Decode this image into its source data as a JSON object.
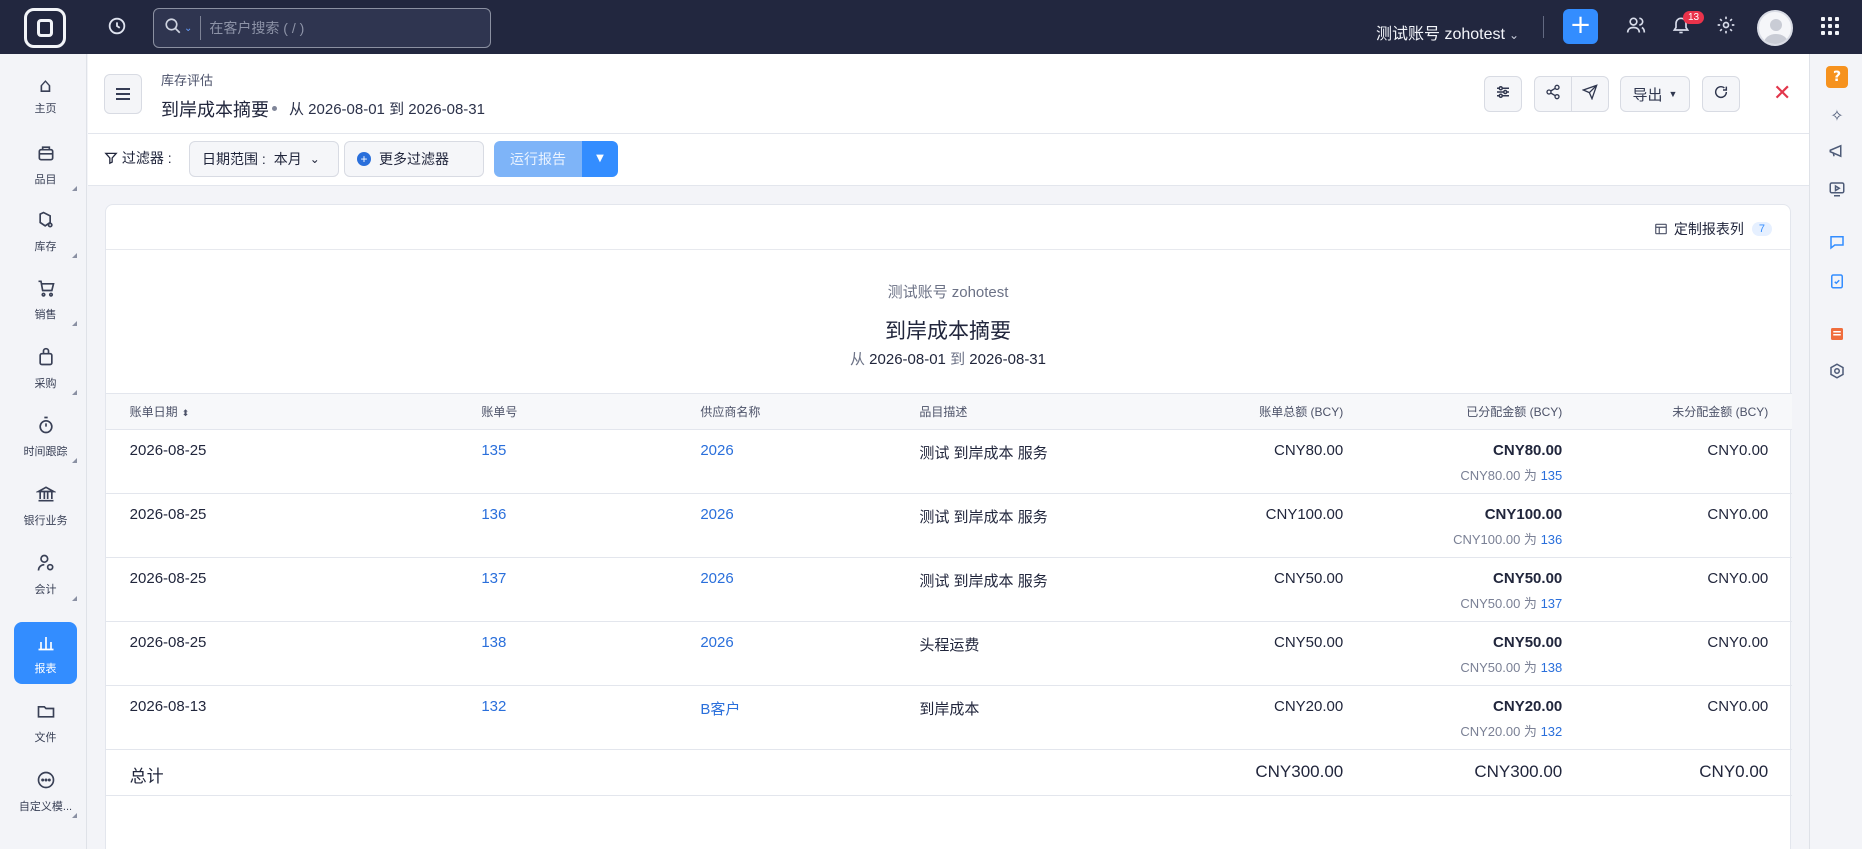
{
  "topbar": {
    "search_placeholder": "在客户搜索 ( / )",
    "org_name": "测试账号 zohotest",
    "notification_count": "13",
    "add_label": "+"
  },
  "sidebar": {
    "items": [
      {
        "label": "主页",
        "icon": "home-icon"
      },
      {
        "label": "品目",
        "icon": "items-icon"
      },
      {
        "label": "库存",
        "icon": "inventory-icon"
      },
      {
        "label": "销售",
        "icon": "cart-icon"
      },
      {
        "label": "采购",
        "icon": "bag-icon"
      },
      {
        "label": "时间跟踪",
        "icon": "stopwatch-icon"
      },
      {
        "label": "银行业务",
        "icon": "bank-icon"
      },
      {
        "label": "会计",
        "icon": "accountant-icon"
      },
      {
        "label": "报表",
        "icon": "reports-icon"
      },
      {
        "label": "文件",
        "icon": "folder-icon"
      },
      {
        "label": "自定义模...",
        "icon": "more-icon"
      }
    ],
    "active": "报表"
  },
  "header": {
    "breadcrumb": "库存评估",
    "title": "到岸成本摘要",
    "range_text": "从 2026-08-01 到 2026-08-31",
    "export_label": "导出"
  },
  "filters": {
    "label": "过滤器 :",
    "date_range_label": "日期范围 :",
    "date_range_value": "本月",
    "more_filters_label": "更多过滤器",
    "run_report_label": "运行报告"
  },
  "report": {
    "customize_columns_label": "定制报表列",
    "customize_columns_count": "7",
    "org_name": "测试账号 zohotest",
    "title": "到岸成本摘要",
    "range_from_word": "从",
    "range_start": "2026-08-01",
    "range_to_word": "到",
    "range_end": "2026-08-31",
    "columns": [
      "账单日期",
      "账单号",
      "供应商名称",
      "品目描述",
      "账单总额 (BCY)",
      "已分配金额 (BCY)",
      "未分配金额 (BCY)"
    ],
    "rows": [
      {
        "date": "2026-08-25",
        "bill_no": "135",
        "vendor": "2026",
        "desc": "测试 到岸成本 服务",
        "total": "CNY80.00",
        "allocated": "CNY80.00",
        "allocated_detail": "CNY80.00 为",
        "allocated_ref": "135",
        "unallocated": "CNY0.00"
      },
      {
        "date": "2026-08-25",
        "bill_no": "136",
        "vendor": "2026",
        "desc": "测试 到岸成本 服务",
        "total": "CNY100.00",
        "allocated": "CNY100.00",
        "allocated_detail": "CNY100.00 为",
        "allocated_ref": "136",
        "unallocated": "CNY0.00"
      },
      {
        "date": "2026-08-25",
        "bill_no": "137",
        "vendor": "2026",
        "desc": "测试 到岸成本 服务",
        "total": "CNY50.00",
        "allocated": "CNY50.00",
        "allocated_detail": "CNY50.00 为",
        "allocated_ref": "137",
        "unallocated": "CNY0.00"
      },
      {
        "date": "2026-08-25",
        "bill_no": "138",
        "vendor": "2026",
        "desc": "头程运费",
        "total": "CNY50.00",
        "allocated": "CNY50.00",
        "allocated_detail": "CNY50.00 为",
        "allocated_ref": "138",
        "unallocated": "CNY0.00"
      },
      {
        "date": "2026-08-13",
        "bill_no": "132",
        "vendor": "B客户",
        "desc": "到岸成本",
        "total": "CNY20.00",
        "allocated": "CNY20.00",
        "allocated_detail": "CNY20.00 为",
        "allocated_ref": "132",
        "unallocated": "CNY0.00"
      }
    ],
    "total_row": {
      "label": "总计",
      "total": "CNY300.00",
      "allocated": "CNY300.00",
      "unallocated": "CNY0.00"
    }
  },
  "colors": {
    "topbar_bg": "#22273f",
    "accent": "#338dff",
    "link": "#2a6fdb",
    "close_red": "#e2364b"
  }
}
